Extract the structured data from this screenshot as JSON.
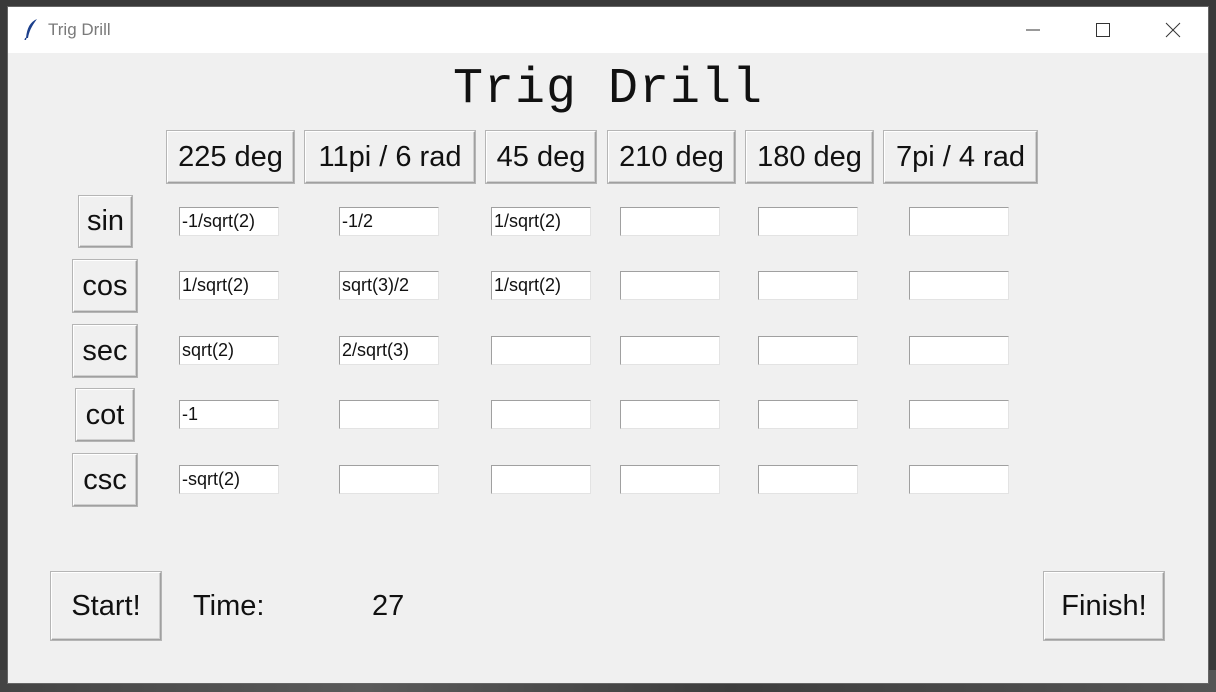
{
  "window": {
    "title": "Trig Drill"
  },
  "heading": "Trig Drill",
  "angles": [
    "225 deg",
    "11pi / 6 rad",
    "45 deg",
    "210 deg",
    "180 deg",
    "7pi / 4 rad"
  ],
  "functions": [
    "sin",
    "cos",
    "sec",
    "cot",
    "csc"
  ],
  "answers": [
    [
      "-1/sqrt(2)",
      "-1/2",
      "1/sqrt(2)",
      "",
      "",
      ""
    ],
    [
      "1/sqrt(2)",
      "sqrt(3)/2",
      "1/sqrt(2)",
      "",
      "",
      ""
    ],
    [
      "sqrt(2)",
      "2/sqrt(3)",
      "",
      "",
      "",
      ""
    ],
    [
      "-1",
      "",
      "",
      "",
      "",
      ""
    ],
    [
      "-sqrt(2)",
      "",
      "",
      "",
      "",
      ""
    ]
  ],
  "controls": {
    "start_label": "Start!",
    "time_label": "Time:",
    "time_value": "27",
    "finish_label": "Finish!"
  },
  "icons": {
    "app": "feather-icon",
    "minimize": "minimize-icon",
    "maximize": "maximize-icon",
    "close": "close-icon"
  }
}
